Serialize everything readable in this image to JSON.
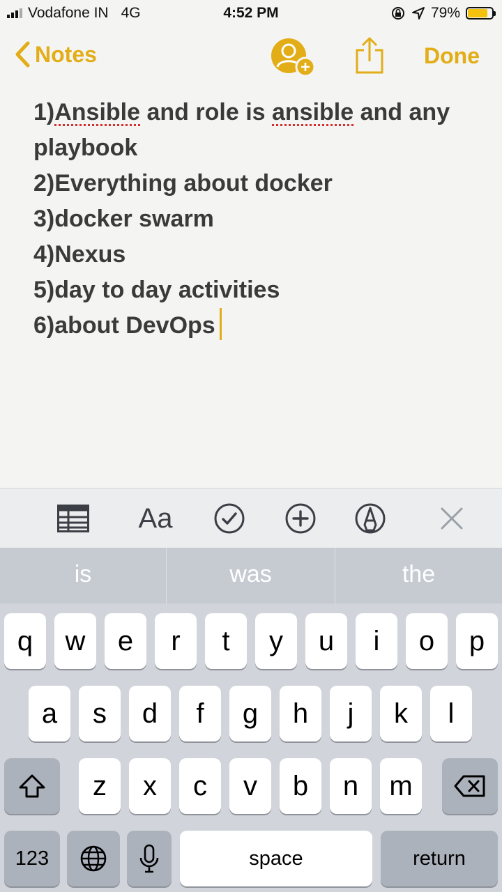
{
  "status_bar": {
    "carrier": "Vodafone IN",
    "network": "4G",
    "time": "4:52 PM",
    "battery": "79%"
  },
  "nav": {
    "back_label": "Notes",
    "done_label": "Done"
  },
  "note": {
    "lines": [
      {
        "num": "1)",
        "w1": "Ansible",
        "mid": " and role is ",
        "w2": "ansible",
        "end": " and any"
      },
      "playbook",
      "2)Everything about docker",
      "3)docker swarm",
      "4)Nexus",
      "5)day to day activities",
      "6)about DevOps"
    ]
  },
  "toolbar": {
    "format_label": "Aa"
  },
  "suggestions": [
    "is",
    "was",
    "the"
  ],
  "keyboard": {
    "row1": [
      "q",
      "w",
      "e",
      "r",
      "t",
      "y",
      "u",
      "i",
      "o",
      "p"
    ],
    "row2": [
      "a",
      "s",
      "d",
      "f",
      "g",
      "h",
      "j",
      "k",
      "l"
    ],
    "row3": [
      "z",
      "x",
      "c",
      "v",
      "b",
      "n",
      "m"
    ],
    "numbers_label": "123",
    "space_label": "space",
    "return_label": "return"
  },
  "colors": {
    "accent": "#e2ad17",
    "text": "#3a3a3a",
    "spellcheck": "#d62d2d"
  }
}
